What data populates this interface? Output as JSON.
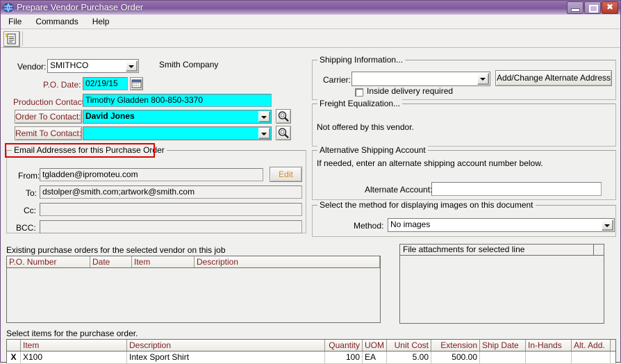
{
  "window": {
    "title": "Prepare Vendor Purchase Order",
    "icon": "app-globe-icon",
    "buttons": {
      "minimize": "minimize",
      "maximize": "maximize",
      "close": "✖"
    }
  },
  "menu": {
    "items": [
      "File",
      "Commands",
      "Help"
    ]
  },
  "toolbar": {
    "icon": "notes-document-icon"
  },
  "vendor": {
    "label": "Vendor:",
    "value": "SMITHCO",
    "company_name": "Smith Company",
    "po_date_label": "P.O. Date:",
    "po_date": "02/19/15",
    "calendar_icon": "calendar-icon",
    "production_contact_label": "Production Contact:",
    "production_contact": "Timothy Gladden  800-850-3370",
    "order_to_contact_label": "Order To Contact:",
    "order_to_contact": "David Jones",
    "remit_to_contact_label": "Remit To Contact:",
    "remit_to_contact": "",
    "lookup_icon": "magnifier-icon"
  },
  "email": {
    "group_title": "Email Addresses for this Purchase Order",
    "from_label": "From:",
    "from": "tgladden@ipromoteu.com",
    "edit_label": "Edit",
    "to_label": "To:",
    "to": "dstolper@smith.com;artwork@smith.com",
    "cc_label": "Cc:",
    "cc": "",
    "bcc_label": "BCC:",
    "bcc": ""
  },
  "shipping": {
    "group_title": "Shipping Information...",
    "carrier_label": "Carrier:",
    "carrier": "",
    "alt_address_button": "Add/Change Alternate Address",
    "inside_delivery_label": "Inside delivery required",
    "inside_delivery_checked": false
  },
  "freight": {
    "group_title": "Freight Equalization...",
    "message": "Not offered by this vendor."
  },
  "alt_account": {
    "group_title": "Alternative Shipping Account",
    "hint": "If needed, enter an alternate shipping account number below.",
    "field_label": "Alternate Account:",
    "value": ""
  },
  "images": {
    "group_title": "Select the method for displaying images on this document",
    "method_label": "Method:",
    "method": "No images"
  },
  "existing_pos": {
    "caption": "Existing purchase orders for the selected vendor on this job",
    "columns": [
      "P.O. Number",
      "Date",
      "Item",
      "Description"
    ],
    "rows": []
  },
  "attachments": {
    "title": "File attachments for selected line",
    "rows": []
  },
  "items": {
    "caption": "Select items for the purchase order.",
    "columns": [
      "",
      "Item",
      "Description",
      "Quantity",
      "UOM",
      "Unit Cost",
      "Extension",
      "Ship Date",
      "In-Hands",
      "Alt. Add."
    ],
    "rows": [
      {
        "selected": "X",
        "item": "X100",
        "description": "Intex  Sport Shirt",
        "quantity": "100",
        "uom": "EA",
        "unit_cost": "5.00",
        "extension": "500.00",
        "ship_date": "",
        "in_hands": "",
        "alt_add": ""
      }
    ]
  },
  "colors": {
    "title_bar": "#7e5a9a",
    "required_field": "#00ffff",
    "label_red": "#7c1f1f",
    "annotation_red": "#e00000",
    "edit_orange": "#d98a16"
  }
}
